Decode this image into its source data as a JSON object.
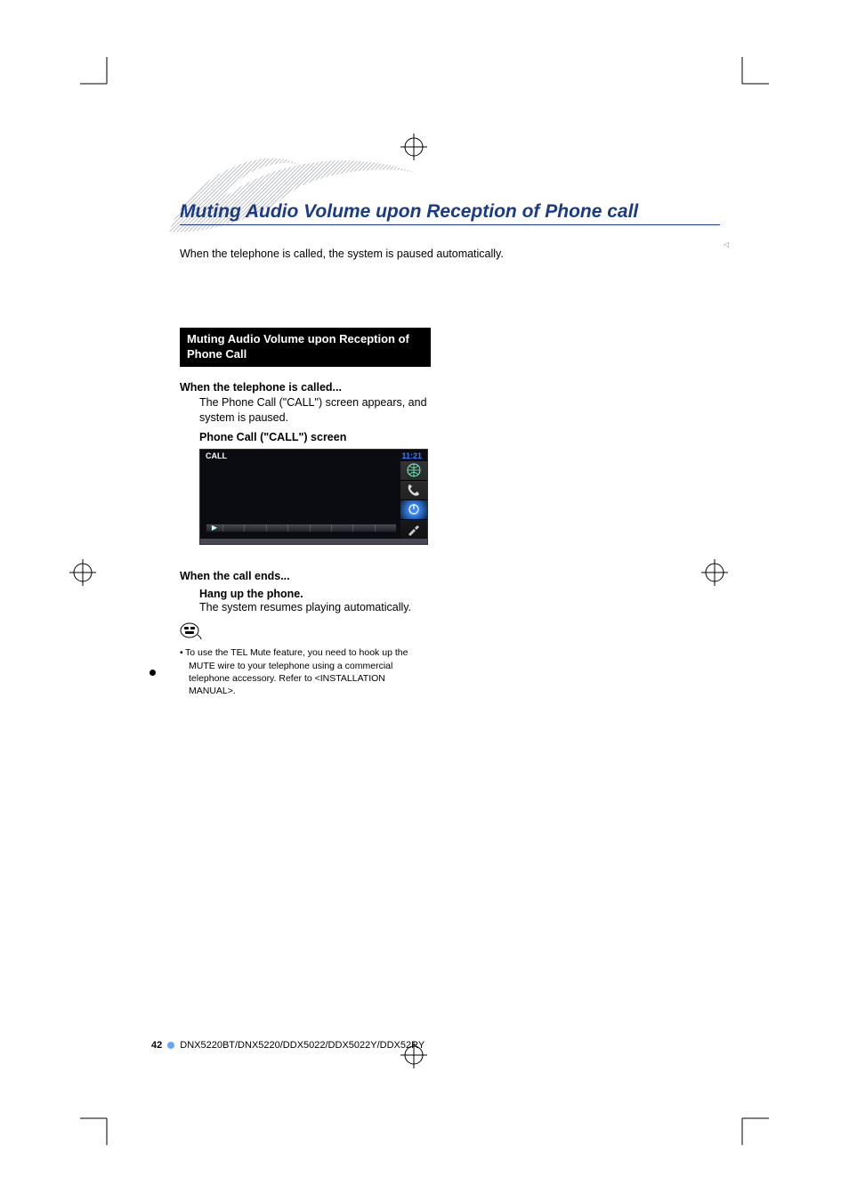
{
  "title": "Muting Audio Volume upon Reception of Phone call",
  "intro": "When the telephone is called, the system is paused automatically.",
  "section_bar": "Muting Audio Volume upon Reception of Phone Call",
  "sub1": "When the telephone is called...",
  "body1": "The Phone Call (\"CALL\") screen appears, and system is paused.",
  "screen_label": "Phone Call (\"CALL\") screen",
  "screen": {
    "title": "CALL",
    "clock": "11:21"
  },
  "sub2": "When the call ends...",
  "body2_bold": "Hang up the phone.",
  "body2": "The system resumes playing automatically.",
  "note_bullet": "To use the TEL Mute feature, you need to hook up the MUTE wire to your telephone using a commercial telephone accessory. Refer to <INSTALLATION MANUAL>.",
  "footer_page": "42",
  "footer_models": "DNX5220BT/DNX5220/DDX5022/DDX5022Y/DDX52RY"
}
